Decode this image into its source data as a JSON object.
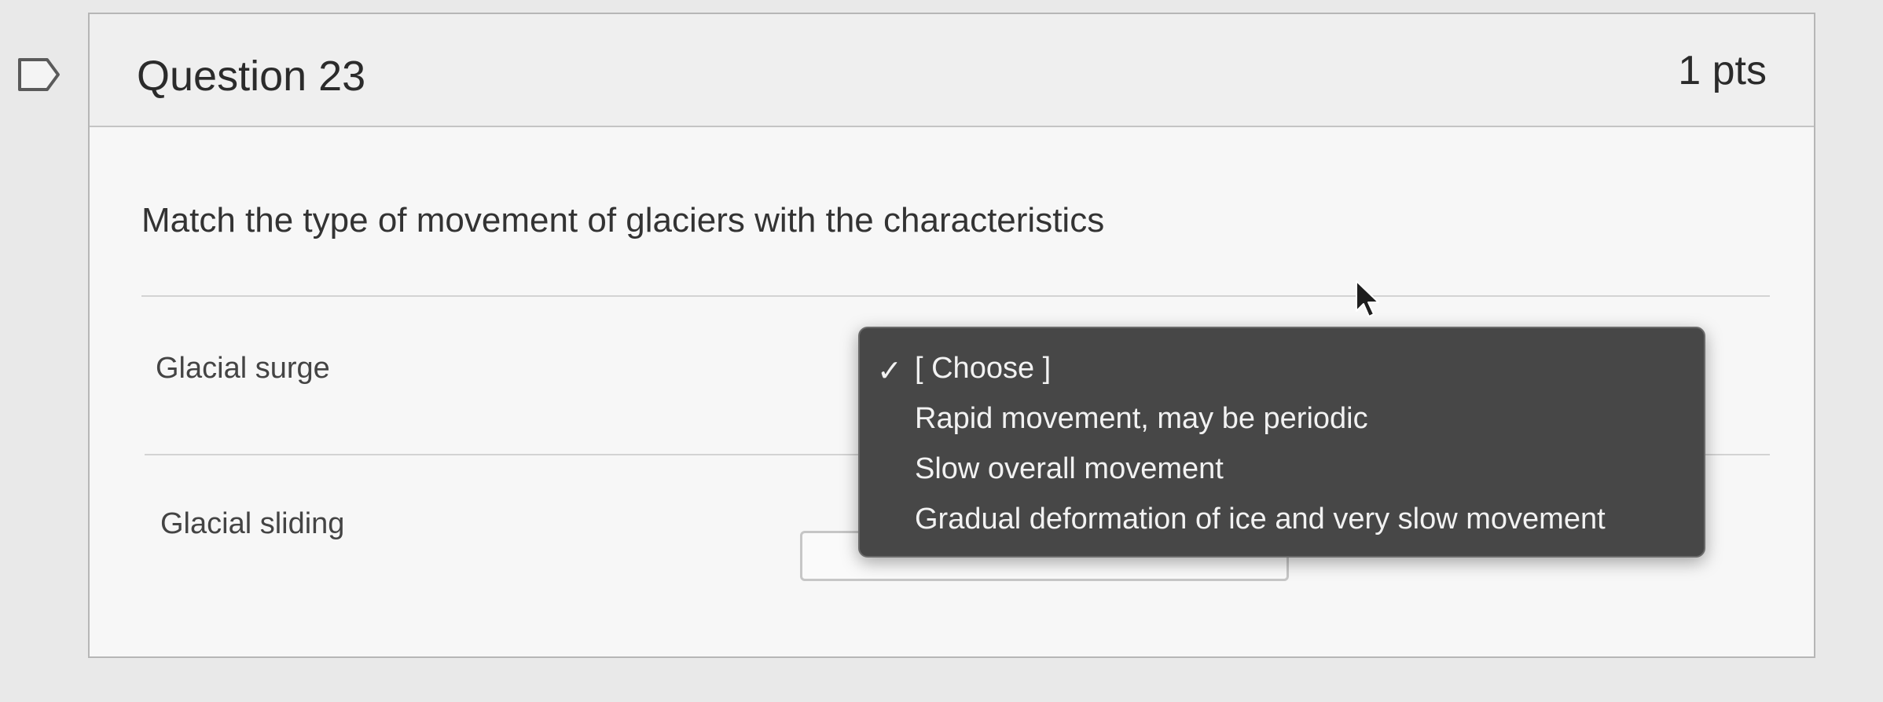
{
  "question": {
    "title": "Question 23",
    "points": "1 pts",
    "prompt": "Match the type of movement of glaciers with the characteristics"
  },
  "rows": [
    {
      "label": "Glacial surge"
    },
    {
      "label": "Glacial sliding"
    }
  ],
  "dropdown": {
    "selected_marker": "✓",
    "options": [
      "[ Choose ]",
      "Rapid movement, may be periodic",
      "Slow overall movement",
      "Gradual deformation of ice and very slow movement"
    ]
  },
  "icons": {
    "flag": "flag-icon",
    "check": "checkmark-icon",
    "cursor": "mouse-pointer-icon"
  },
  "colors": {
    "dropdown_bg": "#474747",
    "card_bg": "#f7f7f7",
    "header_bg": "#efefef"
  }
}
